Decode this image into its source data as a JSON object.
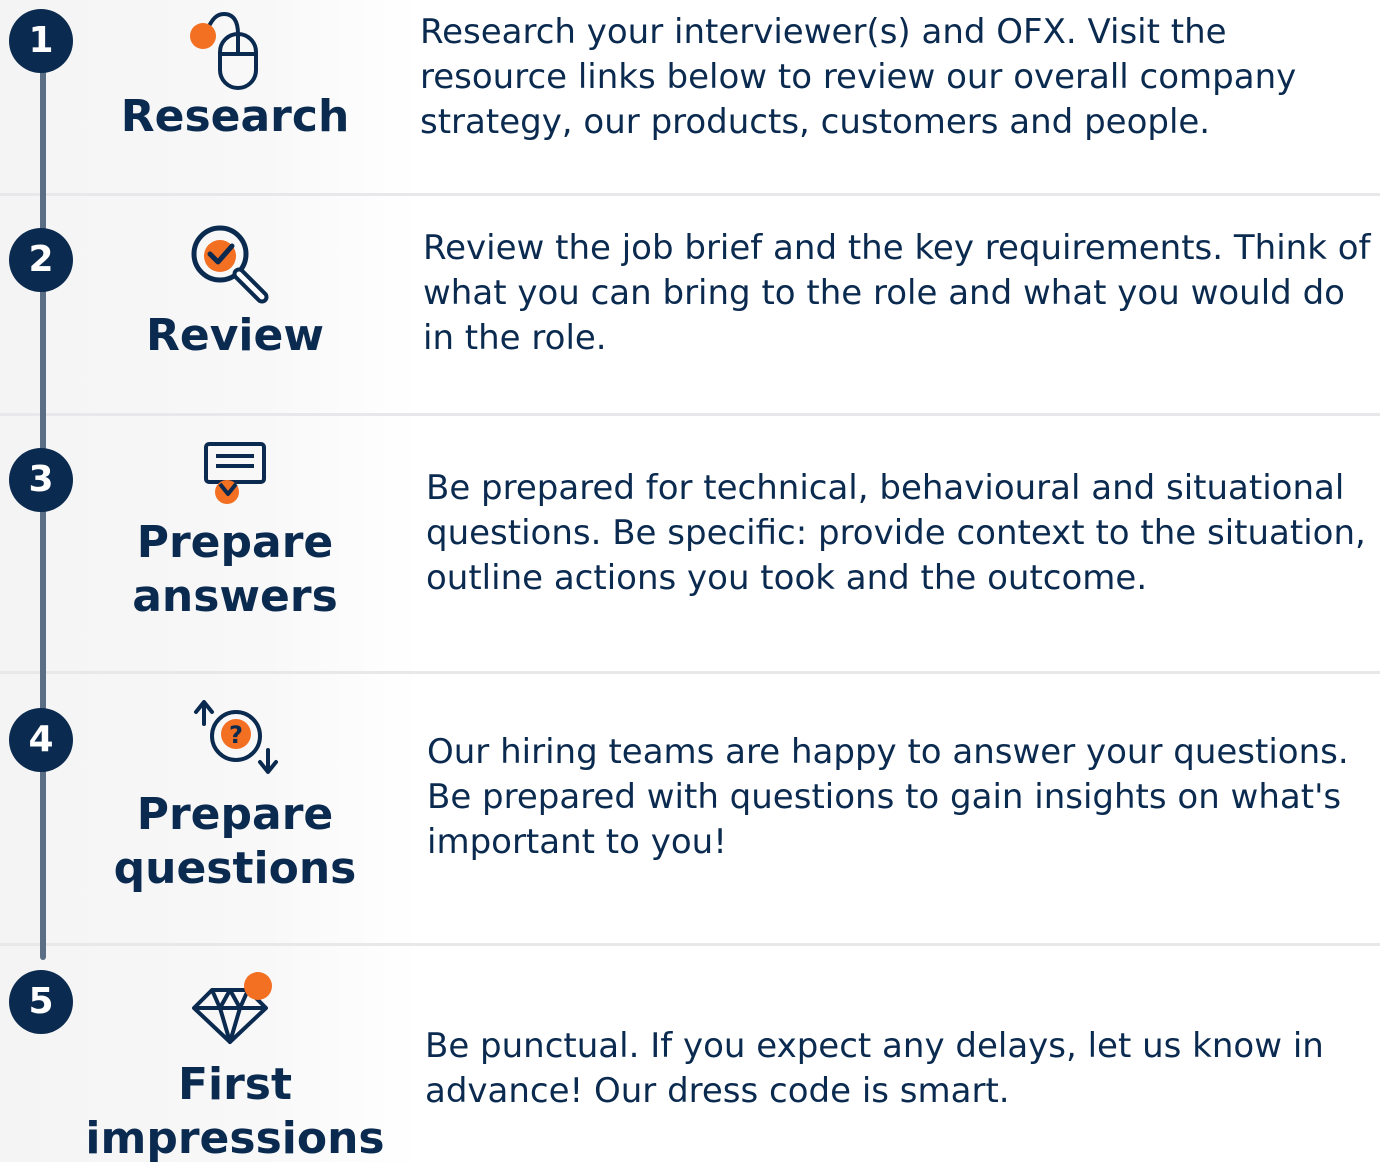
{
  "colors": {
    "navy": "#0b2a4f",
    "accent_orange": "#f36f21",
    "timeline_gray": "#5a6f86",
    "divider": "#e8e8ea"
  },
  "steps": [
    {
      "number": "1",
      "icon": "mouse-icon",
      "title_lines": [
        "Research"
      ],
      "description": "Research your interviewer(s) and OFX. Visit the resource links below to review our overall company strategy, our products, customers and people."
    },
    {
      "number": "2",
      "icon": "magnifier-check-icon",
      "title_lines": [
        "Review"
      ],
      "description": "Review the job brief and the key requirements. Think of what you can bring to the role and what you would do in the role."
    },
    {
      "number": "3",
      "icon": "chat-bubble-icon",
      "title_lines": [
        "Prepare",
        "answers"
      ],
      "description": "Be prepared for technical, behavioural and situational questions. Be specific: provide context to the situation, outline actions you took and the outcome."
    },
    {
      "number": "4",
      "icon": "question-exchange-icon",
      "title_lines": [
        "Prepare",
        "questions"
      ],
      "description": "Our hiring teams are happy to answer your questions. Be prepared with questions to gain insights on what's important to you!"
    },
    {
      "number": "5",
      "icon": "diamond-icon",
      "title_lines": [
        "First",
        "impressions"
      ],
      "description": "Be punctual. If you expect any delays, let us know in advance! Our dress code is smart."
    }
  ]
}
